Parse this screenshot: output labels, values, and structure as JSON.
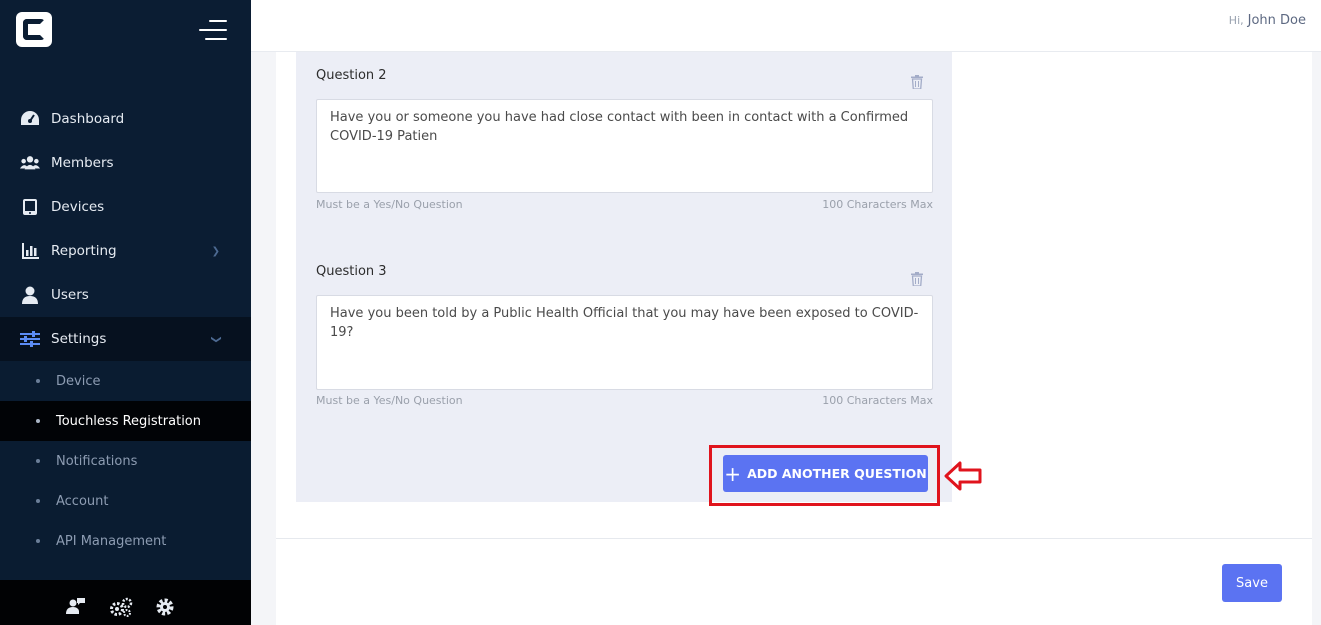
{
  "header": {
    "greeting": "Hi,",
    "user_name": "John Doe"
  },
  "sidebar": {
    "items": [
      {
        "label": "Dashboard",
        "icon": "dashboard-icon"
      },
      {
        "label": "Members",
        "icon": "members-icon"
      },
      {
        "label": "Devices",
        "icon": "tablet-icon"
      },
      {
        "label": "Reporting",
        "icon": "chart-icon"
      },
      {
        "label": "Users",
        "icon": "user-icon"
      },
      {
        "label": "Settings",
        "icon": "sliders-icon"
      }
    ],
    "settings_subitems": [
      {
        "label": "Device"
      },
      {
        "label": "Touchless Registration"
      },
      {
        "label": "Notifications"
      },
      {
        "label": "Account"
      },
      {
        "label": "API Management"
      }
    ],
    "footer_icons": [
      "support-user-icon",
      "gears-icon",
      "settings-gear-icon"
    ]
  },
  "questions": [
    {
      "label": "Question 2",
      "text": "Have you or someone you have had close contact with been in contact with a Confirmed COVID-19 Patien",
      "hint": "Must be a Yes/No Question",
      "limit": "100 Characters Max"
    },
    {
      "label": "Question 3",
      "text": "Have you been told by a Public Health Official that you may have been exposed to COVID-19?",
      "hint": "Must be a Yes/No Question",
      "limit": "100 Characters Max"
    }
  ],
  "actions": {
    "add_question": "ADD ANOTHER QUESTION",
    "save": "Save"
  },
  "colors": {
    "accent": "#5b73f2",
    "sidebar": "#0b1d33",
    "highlight": "#e0141d"
  }
}
